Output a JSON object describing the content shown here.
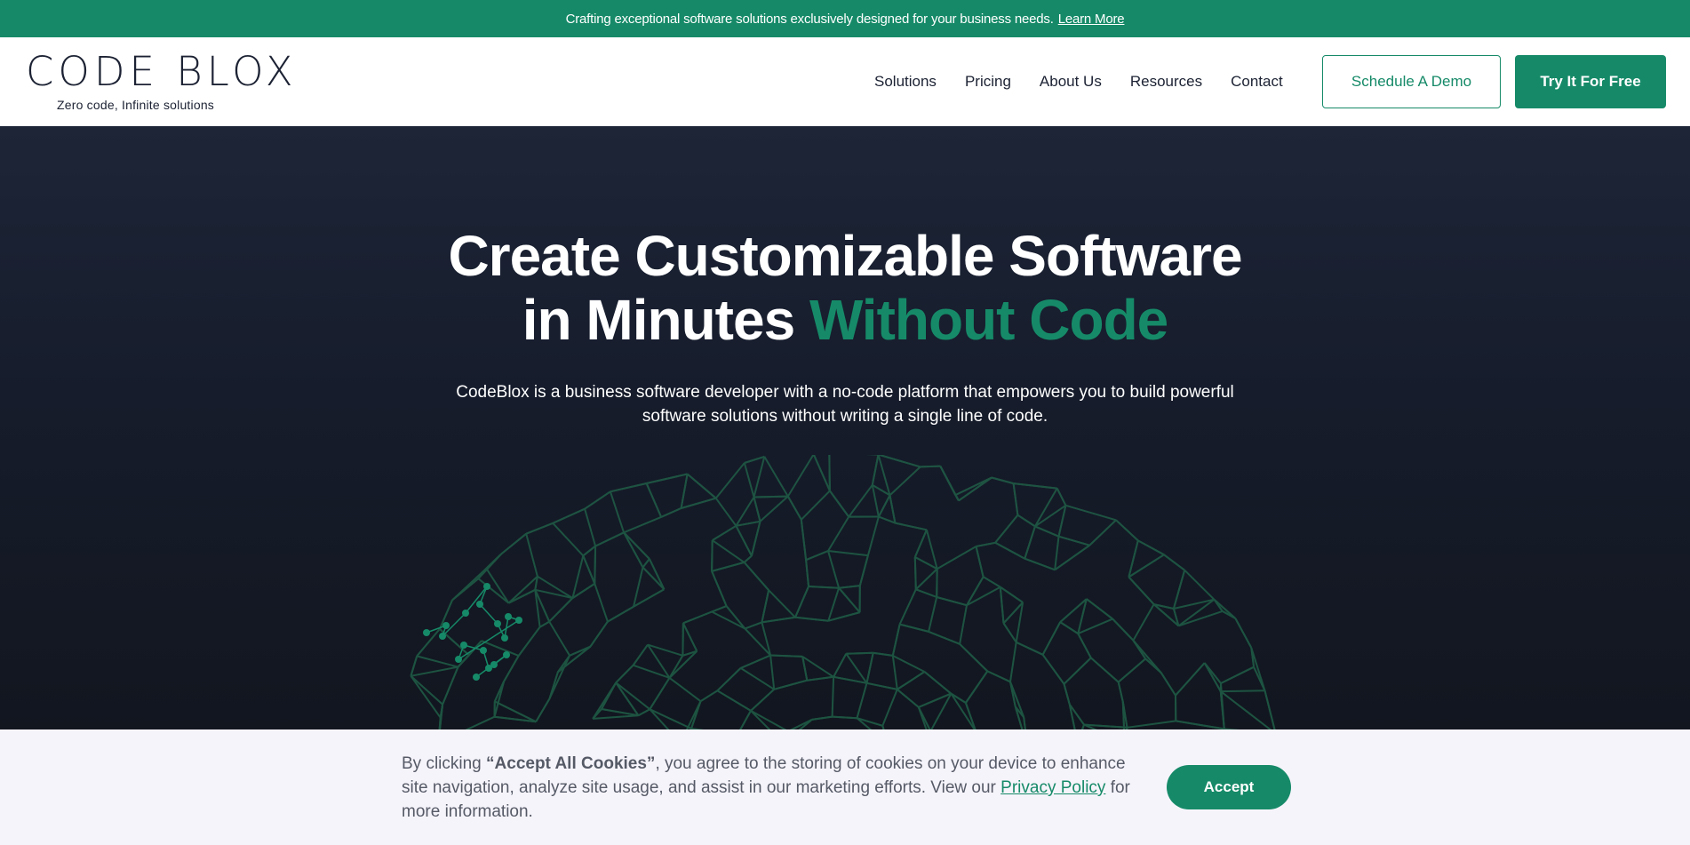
{
  "announcement": {
    "text": "Crafting exceptional software solutions exclusively designed for your business needs.",
    "link": "Learn More"
  },
  "brand": {
    "name": "CODE BLOX",
    "tagline": "Zero code, Infinite solutions"
  },
  "nav": {
    "items": [
      "Solutions",
      "Pricing",
      "About Us",
      "Resources",
      "Contact"
    ],
    "demo_button": "Schedule A Demo",
    "try_button": "Try It For Free"
  },
  "hero": {
    "title_line1": "Create Customizable Software",
    "title_line2": "in Minutes",
    "title_accent": "Without Code",
    "subtitle": "CodeBlox is a business software developer with a no-code platform that empowers you to build powerful software solutions without writing a single line of code."
  },
  "cookie": {
    "prefix": "By clicking ",
    "bold": "“Accept All Cookies”",
    "middle": ", you agree to the storing of cookies on your device to enhance site navigation, analyze site usage, and assist in our marketing efforts. View our ",
    "link": "Privacy Policy",
    "suffix": " for more information.",
    "accept_button": "Accept"
  },
  "colors": {
    "brand_green": "#168a68",
    "dark_navy": "#1c2233",
    "hero_bg": "#161c2b"
  }
}
